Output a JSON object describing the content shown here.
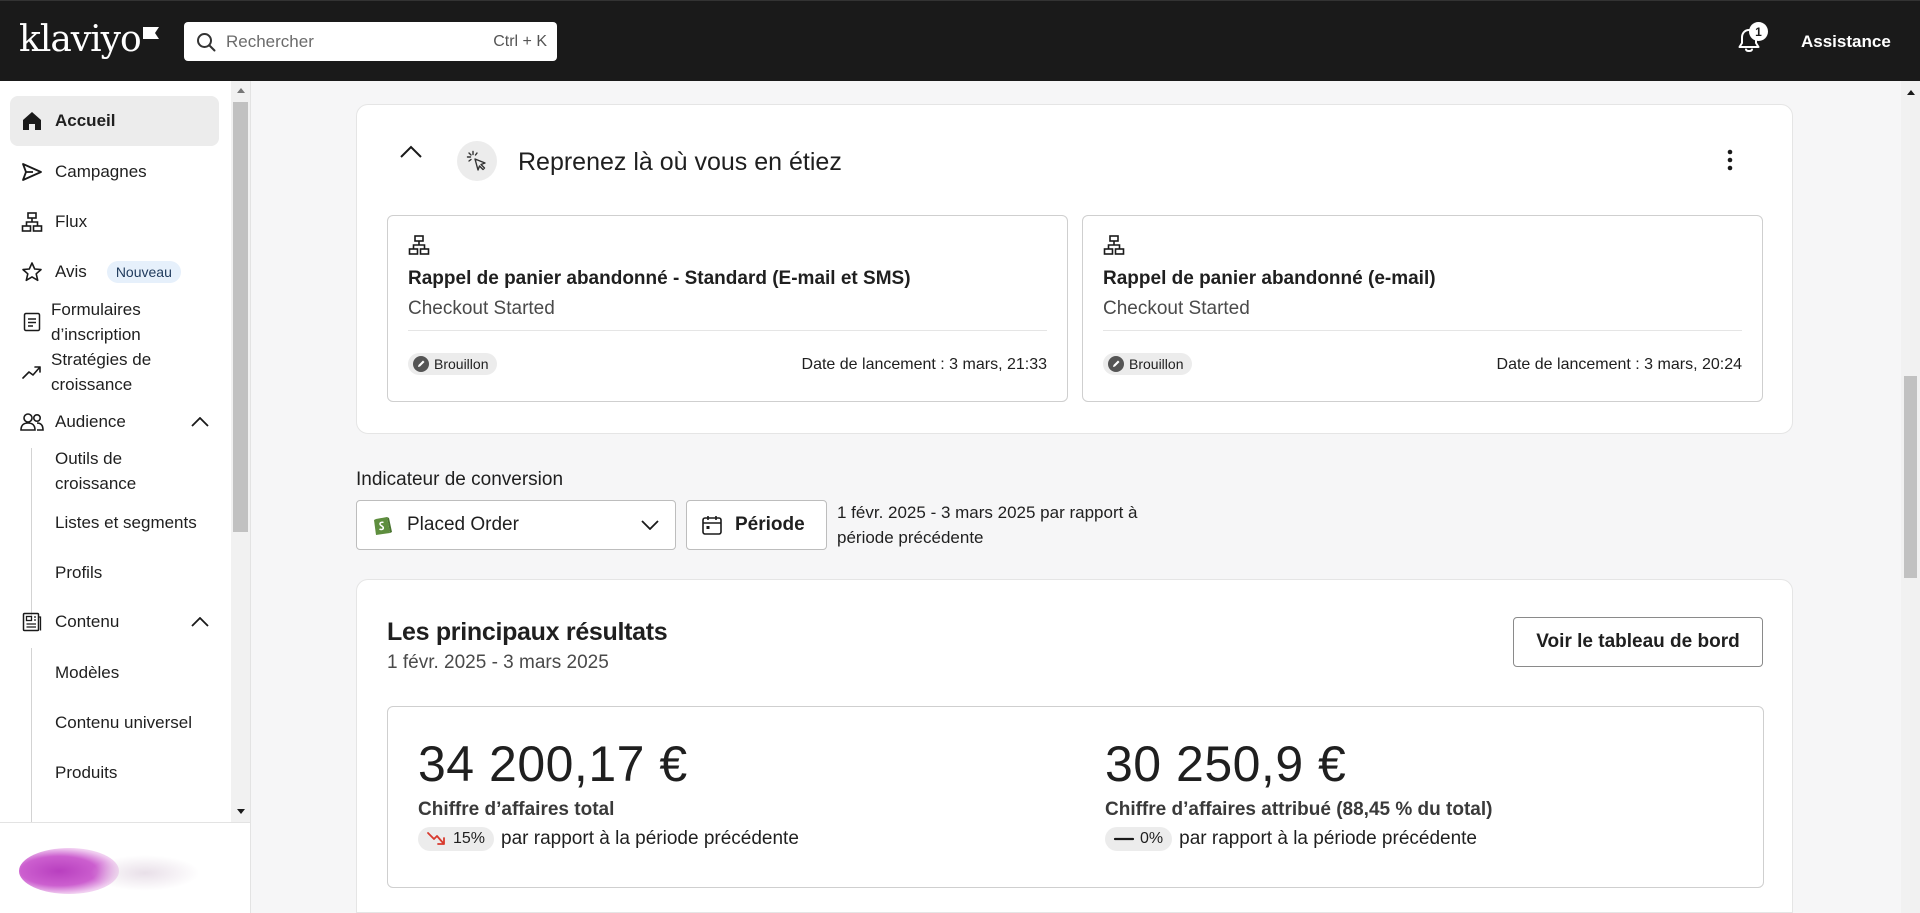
{
  "topbar": {
    "logo_text": "klaviyo",
    "search_placeholder": "Rechercher",
    "search_shortcut": "Ctrl + K",
    "notification_count": "1",
    "help_label": "Assistance"
  },
  "sidebar": {
    "items": [
      {
        "label": "Accueil",
        "icon": "home-icon"
      },
      {
        "label": "Campagnes",
        "icon": "send-icon"
      },
      {
        "label": "Flux",
        "icon": "flow-icon"
      },
      {
        "label": "Avis",
        "icon": "star-icon",
        "badge": "Nouveau"
      },
      {
        "label": "Formulaires d’inscription",
        "icon": "form-icon"
      },
      {
        "label": "Stratégies de croissance",
        "icon": "trend-icon"
      },
      {
        "label": "Audience",
        "icon": "people-icon"
      },
      {
        "label": "Contenu",
        "icon": "content-icon"
      }
    ],
    "audience_sub": [
      "Outils de croissance",
      "Listes et segments",
      "Profils"
    ],
    "content_sub": [
      "Modèles",
      "Contenu universel",
      "Produits"
    ]
  },
  "resume": {
    "title": "Reprenez là où vous en étiez",
    "cards": [
      {
        "title": "Rappel de panier abandonné - Standard (E-mail et SMS)",
        "trigger": "Checkout Started",
        "status": "Brouillon",
        "date": "Date de lancement : 3 mars, 21:33"
      },
      {
        "title": "Rappel de panier abandonné (e-mail)",
        "trigger": "Checkout Started",
        "status": "Brouillon",
        "date": "Date de lancement : 3 mars, 20:24"
      }
    ]
  },
  "conversion": {
    "label": "Indicateur de conversion",
    "selected": "Placed Order",
    "period_button": "Période",
    "period_text": "1 févr. 2025 - 3 mars 2025 par rapport à période précédente"
  },
  "results": {
    "title": "Les principaux résultats",
    "range": "1 févr. 2025 - 3 mars 2025",
    "dashboard_button": "Voir le tableau de bord",
    "metrics": [
      {
        "value": "34 200,17 €",
        "label": "Chiffre d’affaires total",
        "change": "15%",
        "change_direction": "down",
        "comparison": "par rapport à la période précédente"
      },
      {
        "value": "30 250,9 €",
        "label": "Chiffre d’affaires attribué (88,45 % du total)",
        "change": "0%",
        "change_direction": "flat",
        "comparison": "par rapport à la période précédente"
      }
    ]
  },
  "colors": {
    "topbar_bg": "#1a1a1a",
    "trend_down": "#d83a2e",
    "shopify_green": "#5e8e3e"
  }
}
